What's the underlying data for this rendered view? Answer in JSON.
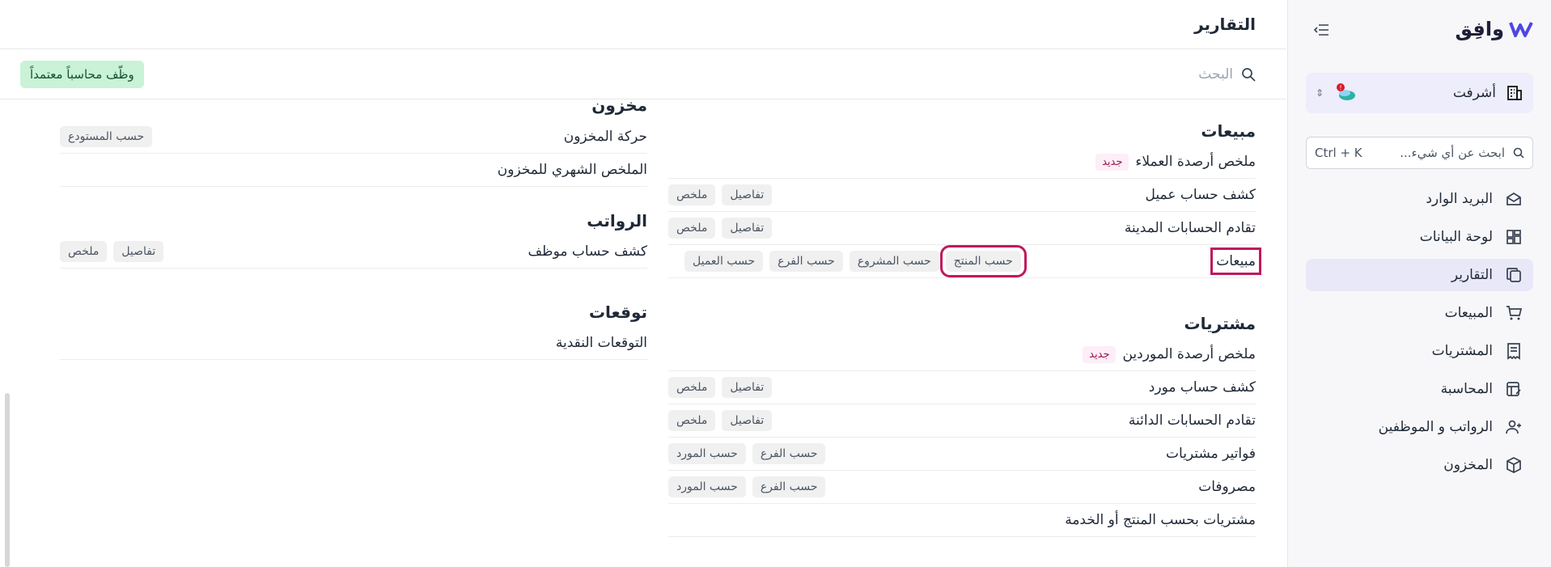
{
  "sidebar": {
    "logo_text": "وافِق",
    "company": {
      "name": "أشرفت"
    },
    "search": {
      "placeholder": "ابحث عن أي شيء...",
      "shortcut": "Ctrl + K"
    },
    "items": [
      {
        "label": "البريد الوارد",
        "icon": "inbox-icon",
        "active": false
      },
      {
        "label": "لوحة البيانات",
        "icon": "dashboard-icon",
        "active": false
      },
      {
        "label": "التقارير",
        "icon": "reports-icon",
        "active": true
      },
      {
        "label": "المبيعات",
        "icon": "cart-icon",
        "active": false
      },
      {
        "label": "المشتريات",
        "icon": "receipt-icon",
        "active": false
      },
      {
        "label": "المحاسبة",
        "icon": "ledger-icon",
        "active": false
      },
      {
        "label": "الرواتب و الموظفين",
        "icon": "users-icon",
        "active": false
      },
      {
        "label": "المخزون",
        "icon": "box-icon",
        "active": false
      }
    ]
  },
  "header": {
    "title": "التقارير"
  },
  "toolbar": {
    "search_placeholder": "البحث",
    "hire_label": "وظّف محاسباً معتمداً"
  },
  "sales": {
    "title": "مبيعات",
    "rows": [
      {
        "label": "ملخص أرصدة العملاء",
        "new": "جديد",
        "tags": []
      },
      {
        "label": "كشف حساب عميل",
        "tags": [
          "ملخص",
          "تفاصيل"
        ]
      },
      {
        "label": "تقادم الحسابات المدينة",
        "tags": [
          "ملخص",
          "تفاصيل"
        ]
      },
      {
        "label": "مبيعات",
        "tags": [
          "حسب العميل",
          "حسب الفرع",
          "حسب المشروع",
          "حسب المنتج"
        ]
      }
    ]
  },
  "purchases": {
    "title": "مشتريات",
    "rows": [
      {
        "label": "ملخص أرصدة الموردين",
        "new": "جديد",
        "tags": []
      },
      {
        "label": "كشف حساب مورد",
        "tags": [
          "ملخص",
          "تفاصيل"
        ]
      },
      {
        "label": "تقادم الحسابات الدائنة",
        "tags": [
          "ملخص",
          "تفاصيل"
        ]
      },
      {
        "label": "فواتير مشتريات",
        "tags": [
          "حسب المورد",
          "حسب الفرع"
        ]
      },
      {
        "label": "مصروفات",
        "tags": [
          "حسب المورد",
          "حسب الفرع"
        ]
      },
      {
        "label": "مشتريات بحسب المنتج أو الخدمة",
        "tags": []
      }
    ]
  },
  "inventory": {
    "title": "مخزون",
    "rows": [
      {
        "label": "حركة المخزون",
        "tags": [
          "حسب المستودع"
        ]
      },
      {
        "label": "الملخص الشهري للمخزون",
        "tags": []
      }
    ]
  },
  "payroll": {
    "title": "الرواتب",
    "rows": [
      {
        "label": "كشف حساب موظف",
        "tags": [
          "ملخص",
          "تفاصيل"
        ]
      }
    ]
  },
  "forecasts": {
    "title": "توقعات",
    "rows": [
      {
        "label": "التوقعات النقدية",
        "tags": []
      }
    ]
  },
  "colors": {
    "accent": "#4f46e5",
    "highlight": "#c0185d",
    "badge": "#c9f2d6"
  }
}
